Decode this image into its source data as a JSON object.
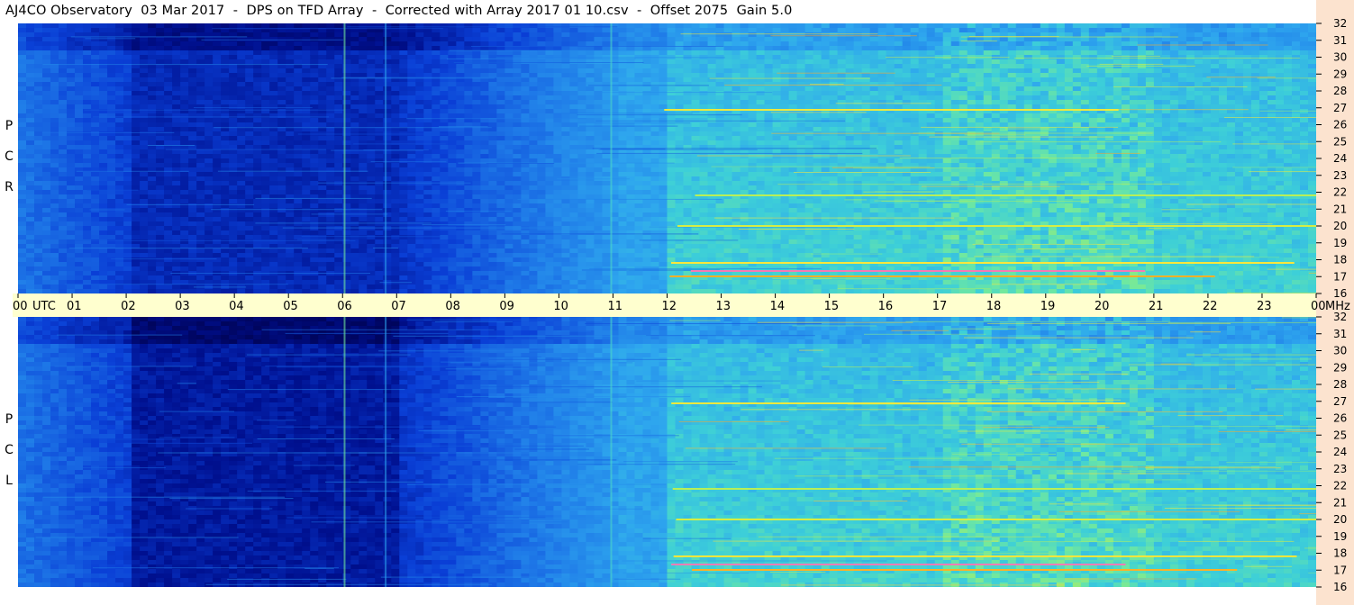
{
  "title": "AJ4CO Observatory  03 Mar 2017  -  DPS on TFD Array  -  Corrected with Array 2017 01 10.csv  -  Offset 2075  Gain 5.0",
  "panels": {
    "top_label": [
      "R",
      "C",
      "P"
    ],
    "bottom_label": [
      "L",
      "C",
      "P"
    ]
  },
  "colors": {
    "right_strip": "#fce3cf",
    "time_bar": "#ffffcf",
    "colormap": [
      "#00004a",
      "#00108f",
      "#0a3fd6",
      "#1f7be8",
      "#2ea6ee",
      "#3dcfd8",
      "#6fe8a0",
      "#c8f048",
      "#ffe63a",
      "#ff8a1a",
      "#e8107a",
      "#ffffff"
    ]
  },
  "chart_data": {
    "type": "heatmap",
    "x_axis": {
      "ticks": [
        "00",
        "UTC",
        "01",
        "02",
        "03",
        "04",
        "05",
        "06",
        "07",
        "08",
        "09",
        "10",
        "11",
        "12",
        "13",
        "14",
        "15",
        "16",
        "17",
        "18",
        "19",
        "20",
        "21",
        "22",
        "23",
        "00",
        "MHz"
      ],
      "range_hours": [
        0,
        24
      ]
    },
    "y_axis": {
      "label": "MHz",
      "ticks": [
        "32",
        "31",
        "30",
        "29",
        "28",
        "27",
        "26",
        "25",
        "24",
        "23",
        "22",
        "21",
        "20",
        "19",
        "18",
        "17",
        "16"
      ],
      "range_mhz": [
        16,
        32
      ]
    },
    "series": [
      {
        "name": "RCP",
        "signal_onset_utc": 11.9,
        "peak_activity_utc": [
          17,
          21
        ]
      },
      {
        "name": "LCP",
        "signal_onset_utc": 11.9,
        "peak_activity_utc": [
          17,
          21
        ]
      }
    ]
  }
}
